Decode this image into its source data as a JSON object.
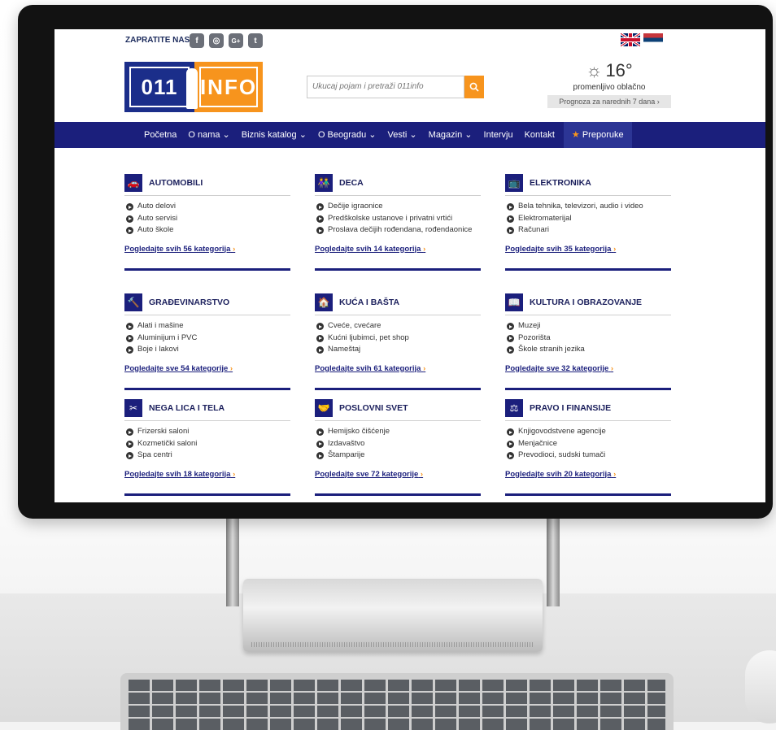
{
  "header": {
    "follow_label": "ZAPRATITE NAS",
    "social": [
      {
        "name": "facebook-icon",
        "glyph": "f"
      },
      {
        "name": "instagram-icon",
        "glyph": "◎"
      },
      {
        "name": "google-plus-icon",
        "glyph": "G+"
      },
      {
        "name": "twitter-icon",
        "glyph": "t"
      }
    ],
    "logo_left": "011",
    "logo_right": "INFO",
    "search_placeholder": "Ukucaj pojam i pretraži 011info",
    "weather": {
      "temperature": "16°",
      "description": "promenljivo oblačno",
      "forecast_link": "Prognoza za narednih 7 dana ›"
    }
  },
  "nav": {
    "items": [
      "Početna",
      "O nama ⌄",
      "Biznis katalog ⌄",
      "O Beogradu ⌄",
      "Vesti ⌄",
      "Magazin ⌄",
      "Intervju",
      "Kontakt"
    ],
    "featured": "Preporuke"
  },
  "categories": [
    {
      "title": "AUTOMOBILI",
      "icon": "car-icon",
      "glyph": "🚗",
      "items": [
        "Auto delovi",
        "Auto servisi",
        "Auto škole"
      ],
      "more": "Pogledajte svih 56 kategorija"
    },
    {
      "title": "DECA",
      "icon": "children-icon",
      "glyph": "👫",
      "items": [
        "Dečije igraonice",
        "Predškolske ustanove i privatni vrtići",
        "Proslava dečijih rođendana, rođendaonice"
      ],
      "more": "Pogledajte svih 14 kategorija"
    },
    {
      "title": "ELEKTRONIKA",
      "icon": "tv-icon",
      "glyph": "📺",
      "items": [
        "Bela tehnika, televizori, audio i video",
        "Elektromaterijal",
        "Računari"
      ],
      "more": "Pogledajte svih 35 kategorija"
    },
    {
      "title": "GRAĐEVINARSTVO",
      "icon": "tools-icon",
      "glyph": "🔨",
      "items": [
        "Alati i mašine",
        "Aluminijum i PVC",
        "Boje i lakovi"
      ],
      "more": "Pogledajte sve 54 kategorije"
    },
    {
      "title": "KUĆA I BAŠTA",
      "icon": "house-icon",
      "glyph": "🏠",
      "items": [
        "Cveće, cvećare",
        "Kućni ljubimci, pet shop",
        "Nameštaj"
      ],
      "more": "Pogledajte svih 61 kategorija"
    },
    {
      "title": "KULTURA I OBRAZOVANJE",
      "icon": "book-icon",
      "glyph": "📖",
      "items": [
        "Muzeji",
        "Pozorišta",
        "Škole stranih jezika"
      ],
      "more": "Pogledajte sve 32 kategorije"
    },
    {
      "title": "NEGA LICA I TELA",
      "icon": "scissors-icon",
      "glyph": "✂",
      "items": [
        "Frizerski saloni",
        "Kozmetički saloni",
        "Spa centri"
      ],
      "more": "Pogledajte svih 18 kategorija"
    },
    {
      "title": "POSLOVNI SVET",
      "icon": "handshake-icon",
      "glyph": "🤝",
      "items": [
        "Hemijsko čišćenje",
        "Izdavaštvo",
        "Štamparije"
      ],
      "more": "Pogledajte sve 72 kategorije"
    },
    {
      "title": "PRAVO I FINANSIJE",
      "icon": "scales-icon",
      "glyph": "⚖",
      "items": [
        "Knjigovodstvene agencije",
        "Menjačnice",
        "Prevodioci, sudski tumači"
      ],
      "more": "Pogledajte svih 20 kategorija"
    }
  ]
}
